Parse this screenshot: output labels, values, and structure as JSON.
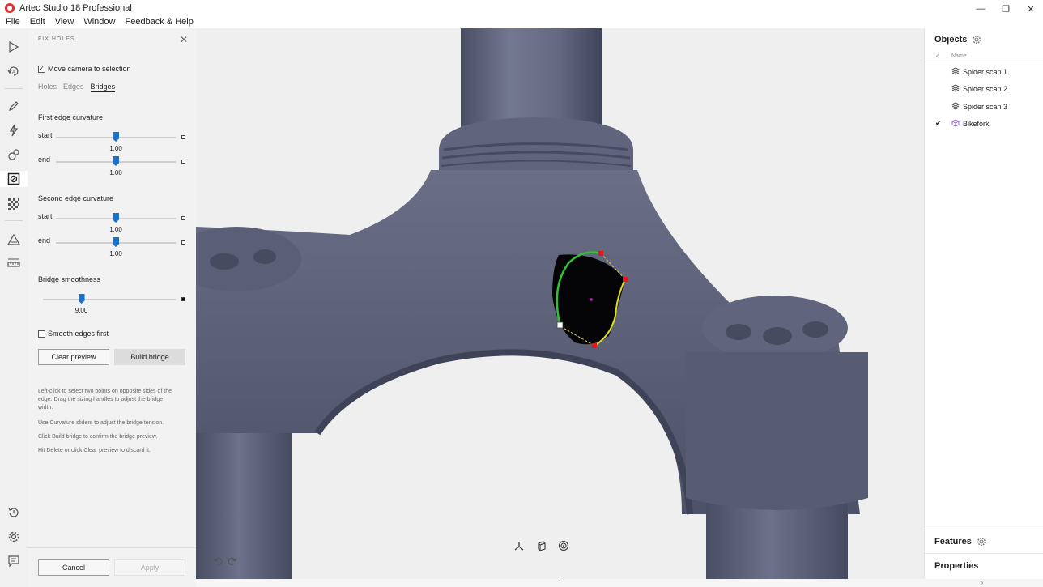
{
  "window": {
    "title": "Artec Studio 18 Professional",
    "minimize": "—",
    "restore": "❐",
    "close": "✕"
  },
  "menu": [
    "File",
    "Edit",
    "View",
    "Window",
    "Feedback & Help"
  ],
  "toolbar": {
    "items": [
      "play-icon",
      "autopilot-icon",
      "edit-pencil-icon",
      "lightning-icon",
      "registration-icon",
      "fix-holes-icon",
      "texture-icon",
      "triangle-icon",
      "measure-icon",
      "history-icon",
      "settings-icon",
      "chat-icon"
    ],
    "active": "fix-holes-icon",
    "expand": "»"
  },
  "panel": {
    "title": "FIX HOLES",
    "close": "✕",
    "move_camera": {
      "label": "Move camera to selection",
      "checked": true
    },
    "tabs": [
      "Holes",
      "Edges",
      "Bridges"
    ],
    "active_tab": "Bridges",
    "first_edge": {
      "label": "First edge curvature",
      "start": {
        "label": "start",
        "value": "1.00",
        "fraction": 0.5
      },
      "end": {
        "label": "end",
        "value": "1.00",
        "fraction": 0.5
      }
    },
    "second_edge": {
      "label": "Second edge curvature",
      "start": {
        "label": "start",
        "value": "1.00",
        "fraction": 0.5
      },
      "end": {
        "label": "end",
        "value": "1.00",
        "fraction": 0.5
      }
    },
    "smoothness": {
      "label": "Bridge smoothness",
      "value": "9.00",
      "fraction": 0.29
    },
    "smooth_edges_first": {
      "label": "Smooth edges first",
      "checked": false
    },
    "clear_preview": "Clear preview",
    "build_bridge": "Build bridge",
    "help": [
      "Left-click to select two points on opposite sides of the edge. Drag the sizing handles to adjust the bridge width.",
      "Use Curvature sliders to adjust the bridge tension.",
      "Click Build bridge to confirm the bridge preview.",
      "Hit Delete or click Clear preview to discard it."
    ],
    "cancel": "Cancel",
    "apply": "Apply"
  },
  "viewport": {
    "model_color": "#5d6177",
    "background": "#efefef",
    "undo": "↶",
    "redo": "↷",
    "tools": [
      "axes-icon",
      "view-cube-icon",
      "spiral-icon"
    ],
    "collapse": "⌃",
    "expand_right": "»"
  },
  "objects": {
    "title": "Objects",
    "column_name": "Name",
    "column_check": "✓",
    "items": [
      {
        "name": "Spider scan 1",
        "checked": false,
        "icon": "layers-icon"
      },
      {
        "name": "Spider scan 2",
        "checked": false,
        "icon": "layers-icon"
      },
      {
        "name": "Spider scan 3",
        "checked": false,
        "icon": "layers-icon"
      },
      {
        "name": "Bikefork",
        "checked": true,
        "icon": "mesh-cube-icon"
      }
    ]
  },
  "features": {
    "title": "Features"
  },
  "properties": {
    "title": "Properties"
  }
}
